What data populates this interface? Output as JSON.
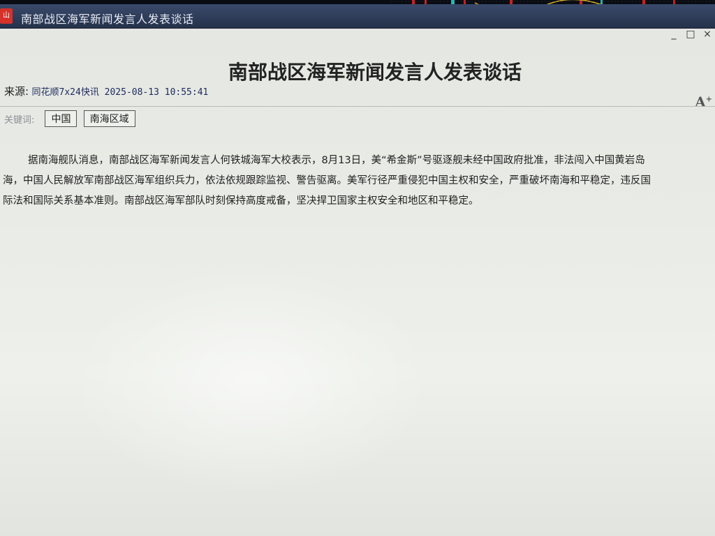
{
  "window": {
    "title": "南部战区海军新闻发言人发表谈话",
    "icon_glyph": "山"
  },
  "controls": {
    "minimize_glyph": "_",
    "maximize_glyph": "□",
    "close_glyph": "×"
  },
  "article": {
    "title": "南部战区海军新闻发言人发表谈话",
    "source_label": "来源:",
    "source_value": "同花顺7x24快讯 2025-08-13 10:55:41",
    "font_size_glyph": "A",
    "font_size_sup": "+",
    "keywords_label": "关键词:",
    "keywords": [
      "中国",
      "南海区域"
    ],
    "body_lines": [
      "据南海舰队消息，南部战区海军新闻发言人何铁城海军大校表示，8月13日，美“希金斯”号驱逐舰未经中国政府批准，非法闯入中国黄岩岛",
      "海，中国人民解放军南部战区海军组织兵力，依法依规跟踪监视、警告驱离。美军行径严重侵犯中国主权和安全，严重破坏南海和平稳定，违反国",
      "际法和国际关系基本准则。南部战区海军部队时刻保持高度戒备，坚决捍卫国家主权安全和地区和平稳定。"
    ]
  },
  "colors": {
    "titlebar": "#2d3a58",
    "source_text": "#1c2a5c",
    "app_icon": "#d5322a"
  }
}
